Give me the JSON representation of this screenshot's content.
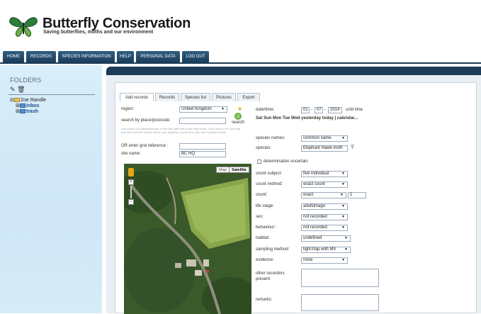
{
  "header": {
    "title": "Butterfly Conservation",
    "tagline": "Saving butterflies, moths and our environment"
  },
  "nav": [
    "HOME",
    "RECORDS",
    "SPECIES INFORMATION",
    "HELP",
    "PERSONAL DATA",
    "LOG OUT"
  ],
  "sidebar": {
    "title": "FOLDERS",
    "tree": {
      "root": "Zoe Randle",
      "inbox": "inbox",
      "trash": "trash"
    }
  },
  "tabs": [
    "Add records",
    "Records",
    "Species list",
    "Pictures",
    "Export"
  ],
  "form": {
    "region_label": "region:",
    "region_value": "United Kingdom",
    "search_label": "search by place/postcode:",
    "search_button": "search",
    "hint": "Use search by place/postcode to find the right part of the map below. Then zoom in on the map and click with the mouse where your sightings occurred or type your location details.",
    "grid_label": "OR enter grid reference :",
    "site_label": "site name:",
    "site_value": "BC HQ",
    "date_label": "date/time:",
    "date_day": "01",
    "date_month": "07",
    "date_year": "2014",
    "until_time": "until time",
    "date_shortcuts": "Sat Sun Mon Tue Wed yesterday today | calendar...",
    "species_names_label": "species names:",
    "species_names_value": "common name",
    "species_label": "species:",
    "species_value": "Elephant Hawk-moth",
    "determination_label": "determination uncertain",
    "count_subject_label": "count subject:",
    "count_subject_value": "five individual",
    "count_method_label": "count method:",
    "count_method_value": "exact count",
    "count_label": "count:",
    "count_value": "exact",
    "count_number": "1",
    "life_stage_label": "life stage:",
    "life_stage_value": "adult/imago",
    "sex_label": "sex:",
    "sex_value": "not recorded",
    "behaviour_label": "behaviour:",
    "behaviour_value": "not recorded",
    "habitat_label": "habitat:",
    "habitat_value": "undefined",
    "sampling_label": "sampling method:",
    "sampling_value": "light-trap with MV",
    "evidence_label": "evidence:",
    "evidence_value": "none",
    "other_recorders_label": "other recorders present:",
    "remarks_label": "remarks:"
  },
  "map": {
    "map_button": "Map",
    "satellite_button": "Satellite"
  },
  "icons": [
    "butterfly-logo",
    "pencil-icon",
    "trash-icon",
    "folder-icon",
    "star-icon",
    "search-icon",
    "zoom-control",
    "map-pin"
  ]
}
